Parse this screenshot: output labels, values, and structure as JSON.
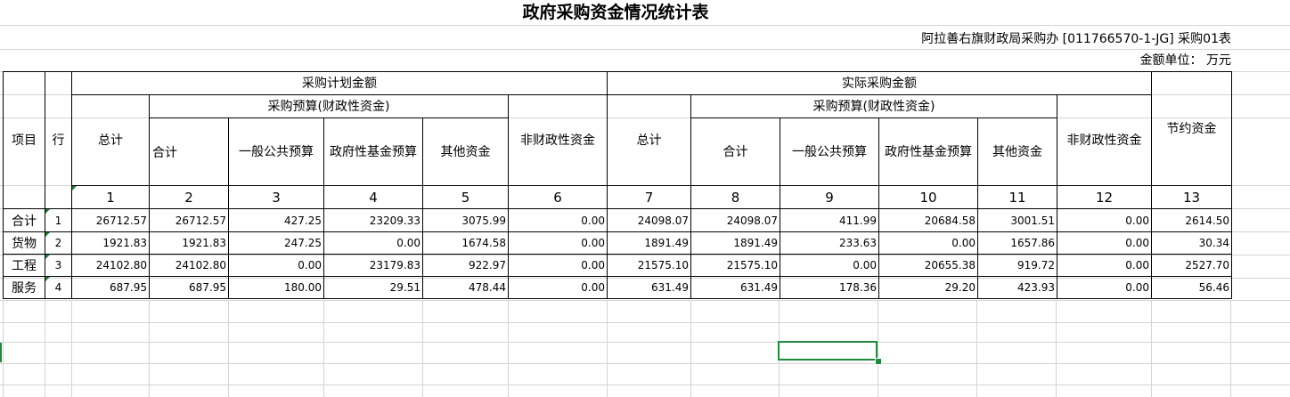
{
  "title": "政府采购资金情况统计表",
  "unit_info": "阿拉善右旗财政局采购办 [011766570-1-JG] 采购01表",
  "amount_unit": "金额单位： 万元",
  "headers": {
    "item": "项目",
    "row": "行",
    "plan_group": "采购计划金额",
    "actual_group": "实际采购金额",
    "budget_group": "采购预算(财政性资金)",
    "total": "总计",
    "subtotal": "合计",
    "general_public": "一般公共预算",
    "gov_fund": "政府性基金预算",
    "other_funds": "其他资金",
    "non_fiscal": "非财政性资金",
    "savings": "节约资金"
  },
  "column_numbers": [
    "1",
    "2",
    "3",
    "4",
    "5",
    "6",
    "7",
    "8",
    "9",
    "10",
    "11",
    "12",
    "13"
  ],
  "rows": [
    {
      "label": "合计",
      "row": "1",
      "values": [
        "26712.57",
        "26712.57",
        "427.25",
        "23209.33",
        "3075.99",
        "0.00",
        "24098.07",
        "24098.07",
        "411.99",
        "20684.58",
        "3001.51",
        "0.00",
        "2614.50"
      ]
    },
    {
      "label": "货物",
      "row": "2",
      "values": [
        "1921.83",
        "1921.83",
        "247.25",
        "0.00",
        "1674.58",
        "0.00",
        "1891.49",
        "1891.49",
        "233.63",
        "0.00",
        "1657.86",
        "0.00",
        "30.34"
      ]
    },
    {
      "label": "工程",
      "row": "3",
      "values": [
        "24102.80",
        "24102.80",
        "0.00",
        "23179.83",
        "922.97",
        "0.00",
        "21575.10",
        "21575.10",
        "0.00",
        "20655.38",
        "919.72",
        "0.00",
        "2527.70"
      ]
    },
    {
      "label": "服务",
      "row": "4",
      "values": [
        "687.95",
        "687.95",
        "180.00",
        "29.51",
        "478.44",
        "0.00",
        "631.49",
        "631.49",
        "178.36",
        "29.20",
        "423.93",
        "0.00",
        "56.46"
      ]
    }
  ],
  "colors": {
    "selection": "#1e8a3c",
    "gridline": "#d4d4d4"
  }
}
